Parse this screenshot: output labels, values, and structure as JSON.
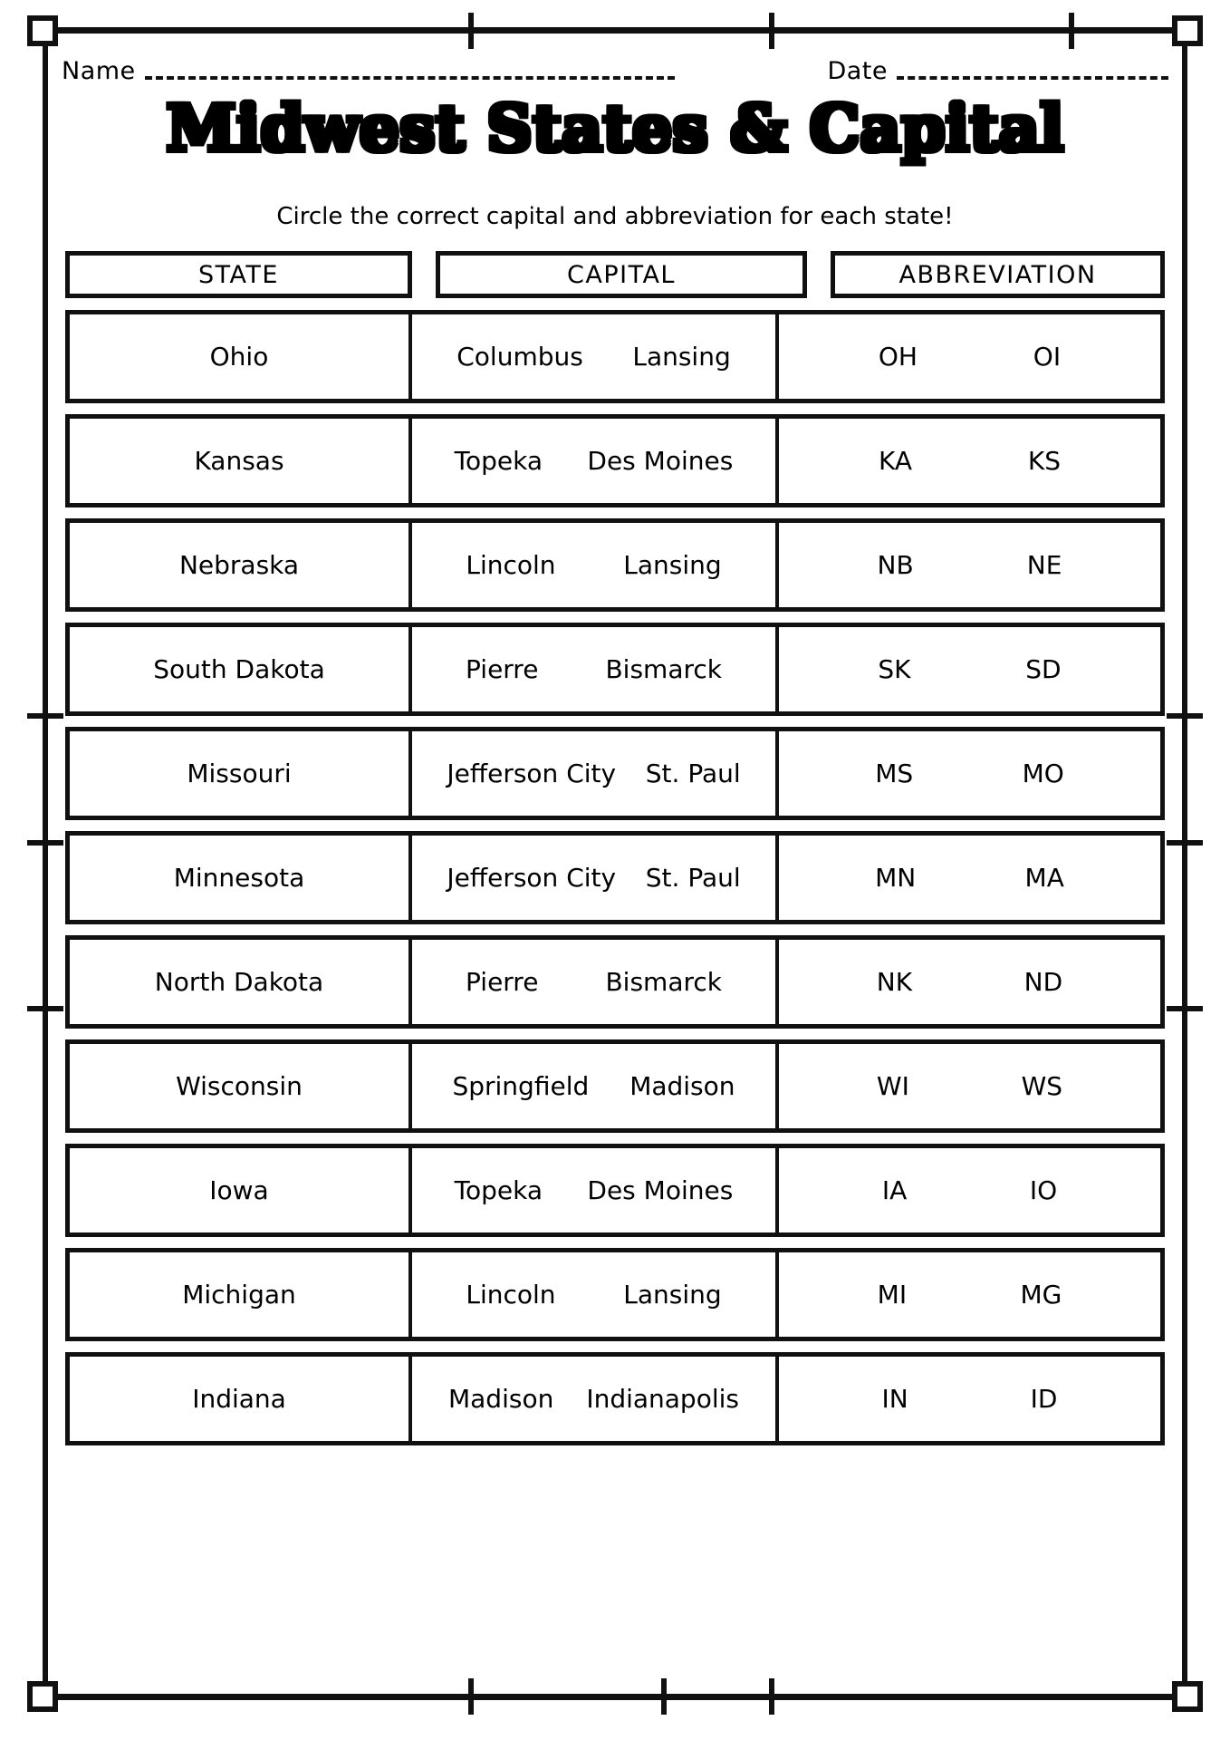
{
  "meta": {
    "name_label": "Name",
    "date_label": "Date"
  },
  "header": {
    "title": "Midwest States & Capital",
    "subtitle": "Circle the correct capital and abbreviation for each state!"
  },
  "table": {
    "columns": [
      "STATE",
      "CAPITAL",
      "ABBREVIATION"
    ],
    "rows": [
      {
        "state": "Ohio",
        "capital_options": [
          "Columbus",
          "Lansing"
        ],
        "abbr_options": [
          "OH",
          "OI"
        ]
      },
      {
        "state": "Kansas",
        "capital_options": [
          "Topeka",
          "Des Moines"
        ],
        "abbr_options": [
          "KA",
          "KS"
        ]
      },
      {
        "state": "Nebraska",
        "capital_options": [
          "Lincoln",
          "Lansing"
        ],
        "abbr_options": [
          "NB",
          "NE"
        ]
      },
      {
        "state": "South Dakota",
        "capital_options": [
          "Pierre",
          "Bismarck"
        ],
        "abbr_options": [
          "SK",
          "SD"
        ]
      },
      {
        "state": "Missouri",
        "capital_options": [
          "Jefferson City",
          "St. Paul"
        ],
        "abbr_options": [
          "MS",
          "MO"
        ]
      },
      {
        "state": "Minnesota",
        "capital_options": [
          "Jefferson City",
          "St. Paul"
        ],
        "abbr_options": [
          "MN",
          "MA"
        ]
      },
      {
        "state": "North Dakota",
        "capital_options": [
          "Pierre",
          "Bismarck"
        ],
        "abbr_options": [
          "NK",
          "ND"
        ]
      },
      {
        "state": "Wisconsin",
        "capital_options": [
          "Springfield",
          "Madison"
        ],
        "abbr_options": [
          "WI",
          "WS"
        ]
      },
      {
        "state": "Iowa",
        "capital_options": [
          "Topeka",
          "Des Moines"
        ],
        "abbr_options": [
          "IA",
          "IO"
        ]
      },
      {
        "state": "Michigan",
        "capital_options": [
          "Lincoln",
          "Lansing"
        ],
        "abbr_options": [
          "MI",
          "MG"
        ]
      },
      {
        "state": "Indiana",
        "capital_options": [
          "Madison",
          "Indianapolis"
        ],
        "abbr_options": [
          "IN",
          "ID"
        ]
      }
    ]
  },
  "colors": {
    "ink": "#111111",
    "paper": "#ffffff"
  }
}
